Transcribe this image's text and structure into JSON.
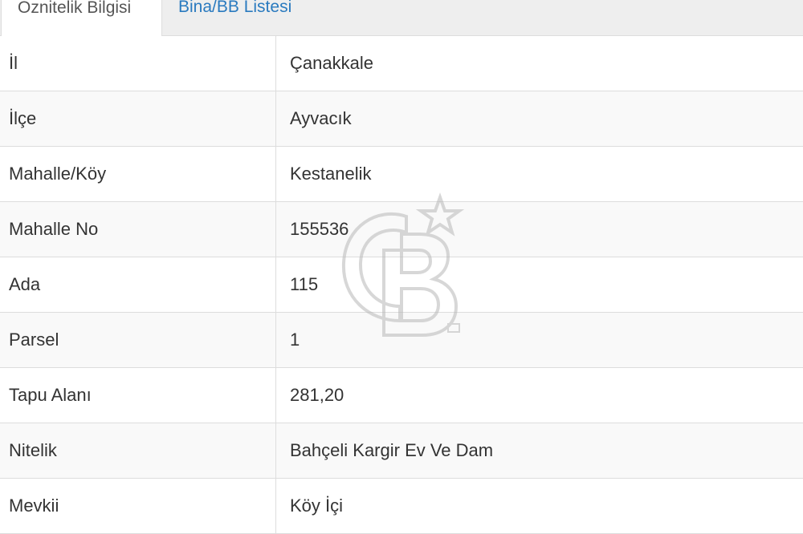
{
  "tabs": [
    {
      "label": "Öznitelik Bilgisi",
      "active": true
    },
    {
      "label": "Bina/BB Listesi",
      "active": false
    }
  ],
  "attributes": [
    {
      "label": "İl",
      "value": "Çanakkale"
    },
    {
      "label": "İlçe",
      "value": "Ayvacık"
    },
    {
      "label": "Mahalle/Köy",
      "value": "Kestanelik"
    },
    {
      "label": "Mahalle No",
      "value": "155536"
    },
    {
      "label": "Ada",
      "value": "115"
    },
    {
      "label": "Parsel",
      "value": "1"
    },
    {
      "label": "Tapu Alanı",
      "value": "281,20"
    },
    {
      "label": "Nitelik",
      "value": "Bahçeli Kargir Ev Ve Dam"
    },
    {
      "label": "Mevkii",
      "value": "Köy İçi"
    }
  ],
  "watermark": {
    "icon": "cb-logo-watermark",
    "color": "#b8b8b8",
    "mark": "SM"
  }
}
